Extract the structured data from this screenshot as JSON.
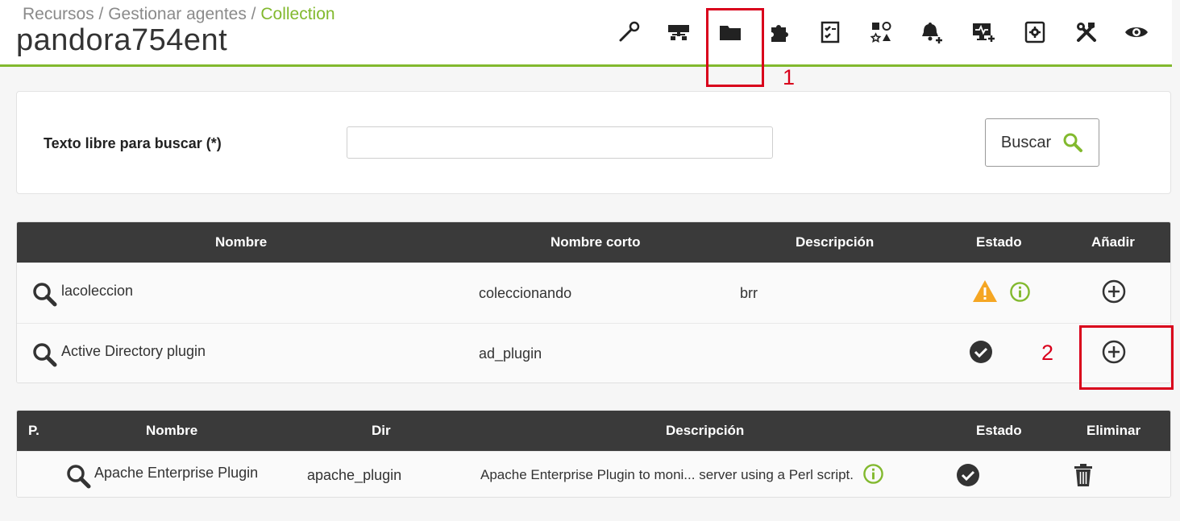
{
  "header": {
    "breadcrumb": {
      "item1": "Recursos",
      "sep1": " / ",
      "item2": "Gestionar agentes",
      "sep2": " / ",
      "item3": "Collection"
    },
    "title": "pandora754ent"
  },
  "toolbar": {
    "icons": [
      "wrench-icon",
      "network-icon",
      "folder-icon",
      "puzzle-icon",
      "checklist-icon",
      "shapes-icon",
      "bell-plus-icon",
      "monitor-plus-icon",
      "settings-box-icon",
      "tools-icon",
      "eye-icon"
    ]
  },
  "annotations": {
    "label1": "1",
    "label2": "2",
    "color": "#d9001b"
  },
  "search": {
    "label": "Texto libre para buscar (*)",
    "value": "",
    "placeholder": "",
    "button_label": "Buscar"
  },
  "available_table": {
    "columns": [
      "Nombre",
      "Nombre corto",
      "Descripción",
      "Estado",
      "Añadir"
    ],
    "rows": [
      {
        "name": "lacoleccion",
        "short_name": "coleccionando",
        "description": "brr",
        "status": "warning-icon + info-icon",
        "add": "plus-circle-icon"
      },
      {
        "name": "Active Directory plugin",
        "short_name": "ad_plugin",
        "description": "",
        "status": "check-circle-icon",
        "add": "plus-circle-icon"
      }
    ]
  },
  "assigned_table": {
    "columns": [
      "P.",
      "Nombre",
      "Dir",
      "Descripción",
      "Estado",
      "Eliminar"
    ],
    "rows": [
      {
        "p": "",
        "name": "Apache Enterprise Plugin",
        "dir": "apache_plugin",
        "description": "Apache Enterprise Plugin to moni... server using a Perl script.",
        "status": "check-circle-icon",
        "delete": "trash-icon"
      }
    ]
  },
  "colors": {
    "accent": "#82b92e",
    "table_header": "#3a3a3a",
    "warning": "#f5a623",
    "highlight": "#d9001b"
  }
}
